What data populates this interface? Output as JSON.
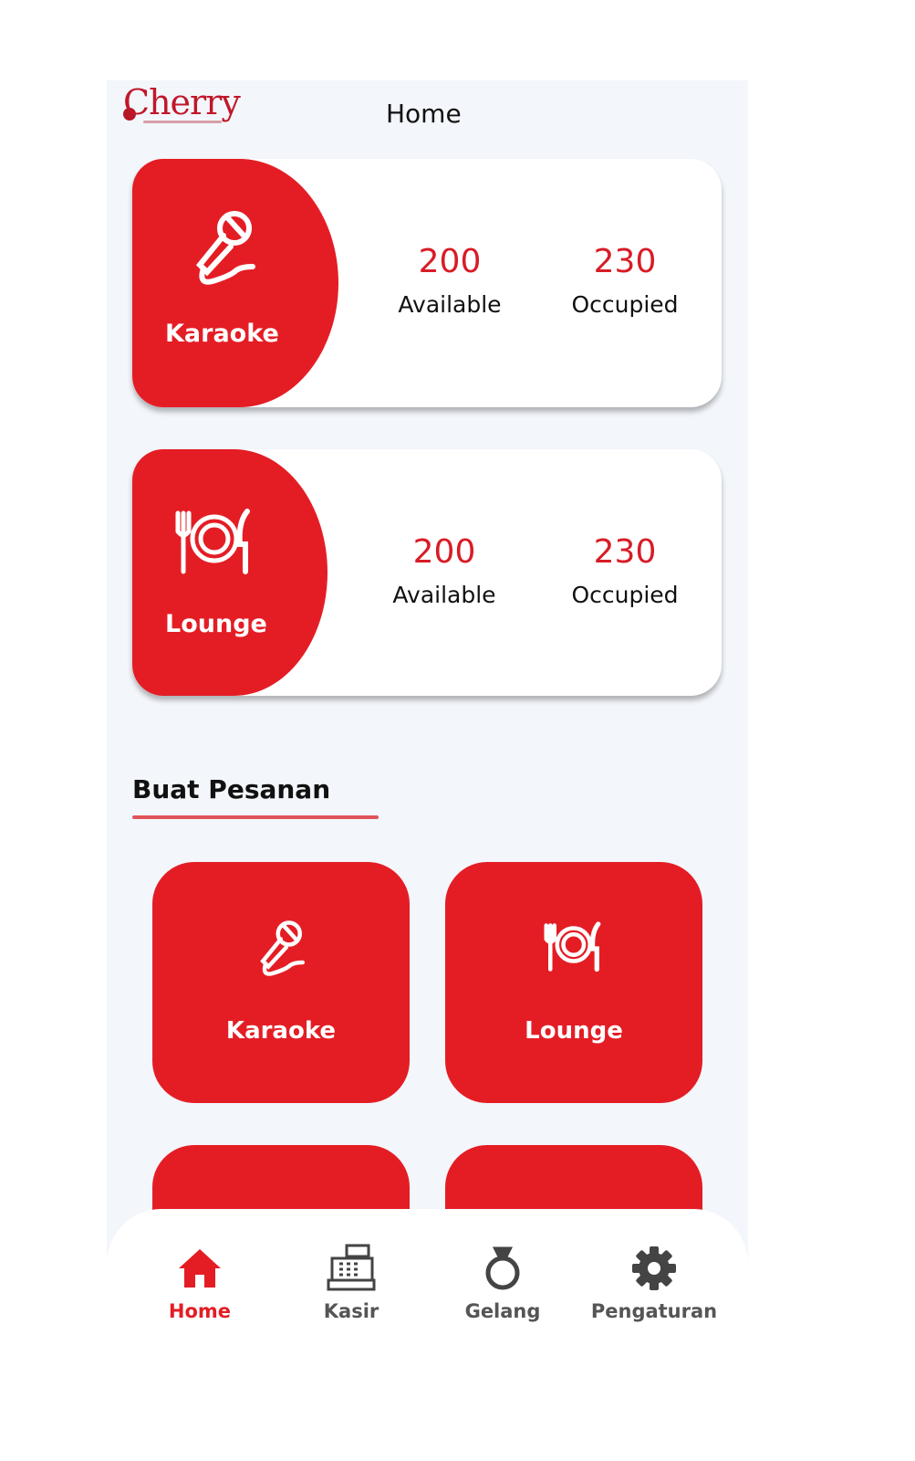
{
  "header": {
    "logo_text": "Cherry",
    "title": "Home"
  },
  "stats": [
    {
      "name": "Karaoke",
      "available": "200",
      "available_label": "Available",
      "occupied": "230",
      "occupied_label": "Occupied",
      "icon": "microphone-icon"
    },
    {
      "name": "Lounge",
      "available": "200",
      "available_label": "Available",
      "occupied": "230",
      "occupied_label": "Occupied",
      "icon": "plate-cutlery-icon"
    }
  ],
  "section": {
    "title": "Buat Pesanan"
  },
  "order_buttons": [
    {
      "label": "Karaoke",
      "icon": "microphone-icon"
    },
    {
      "label": "Lounge",
      "icon": "plate-cutlery-icon"
    },
    {
      "label": "",
      "icon": ""
    },
    {
      "label": "",
      "icon": ""
    }
  ],
  "nav": {
    "items": [
      {
        "label": "Home",
        "icon": "home-icon",
        "active": true
      },
      {
        "label": "Kasir",
        "icon": "cash-register-icon",
        "active": false
      },
      {
        "label": "Gelang",
        "icon": "ring-icon",
        "active": false
      },
      {
        "label": "Pengaturan",
        "icon": "gear-icon",
        "active": false
      }
    ]
  },
  "colors": {
    "accent": "#e41d25",
    "background": "#f3f6fb",
    "text": "#111111",
    "nav_inactive": "#555555"
  }
}
